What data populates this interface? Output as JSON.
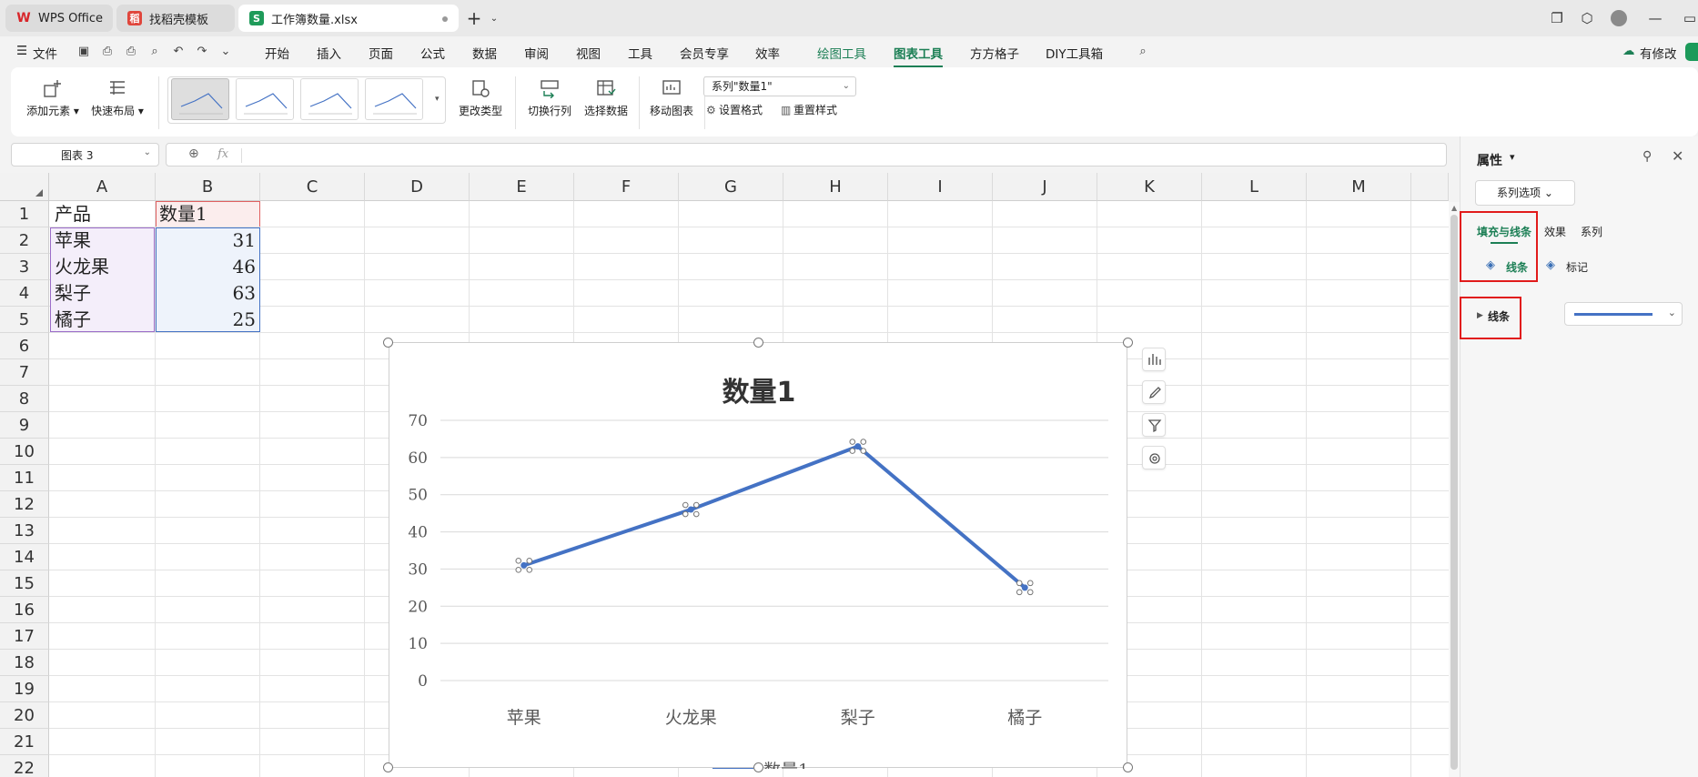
{
  "tabs": [
    {
      "label": "WPS Office"
    },
    {
      "label": "找稻壳模板"
    },
    {
      "label": "工作簿数量.xlsx"
    }
  ],
  "menu": {
    "file": "文件",
    "items": [
      "开始",
      "插入",
      "页面",
      "公式",
      "数据",
      "审阅",
      "视图",
      "工具",
      "会员专享",
      "效率",
      "绘图工具",
      "图表工具",
      "方方格子",
      "DIY工具箱"
    ],
    "active": "图表工具",
    "status": "有修改"
  },
  "ribbon": {
    "add_element": "添加元素",
    "quick_layout": "快速布局",
    "change_type": "更改类型",
    "switch_rowcol": "切换行列",
    "select_data": "选择数据",
    "move_chart": "移动图表",
    "series_select": "系列\"数量1\"",
    "set_format": "设置格式",
    "reset_style": "重置样式"
  },
  "namebox": "图表 3",
  "formula_fx": "fx",
  "sheet": {
    "columns": [
      "A",
      "B",
      "C",
      "D",
      "E",
      "F",
      "G",
      "H",
      "I",
      "J",
      "K",
      "L",
      "M"
    ],
    "rows": [
      "1",
      "2",
      "3",
      "4",
      "5",
      "6",
      "7",
      "8",
      "9",
      "10",
      "11",
      "12",
      "13",
      "14",
      "15",
      "16",
      "17",
      "18",
      "19",
      "20",
      "21",
      "22"
    ],
    "cells": {
      "a1": "产品",
      "b1": "数量1",
      "a2": "苹果",
      "b2": "31",
      "a3": "火龙果",
      "b3": "46",
      "a4": "梨子",
      "b4": "63",
      "a5": "橘子",
      "b5": "25"
    }
  },
  "chart_data": {
    "type": "line",
    "title": "数量1",
    "categories": [
      "苹果",
      "火龙果",
      "梨子",
      "橘子"
    ],
    "series": [
      {
        "name": "数量1",
        "values": [
          31,
          46,
          63,
          25
        ],
        "color": "#4472c4"
      }
    ],
    "ylim": [
      0,
      70
    ],
    "yticks": [
      0,
      10,
      20,
      30,
      40,
      50,
      60,
      70
    ],
    "grid": true,
    "legend": "bottom"
  },
  "panel": {
    "title": "属性",
    "series_options": "系列选项",
    "tabs": [
      "填充与线条",
      "效果",
      "系列"
    ],
    "subtabs": [
      "线条",
      "标记"
    ],
    "section": "线条"
  },
  "colors": {
    "accent": "#1c7f55",
    "highlight": "#e11b1b",
    "series": "#4472c4"
  }
}
